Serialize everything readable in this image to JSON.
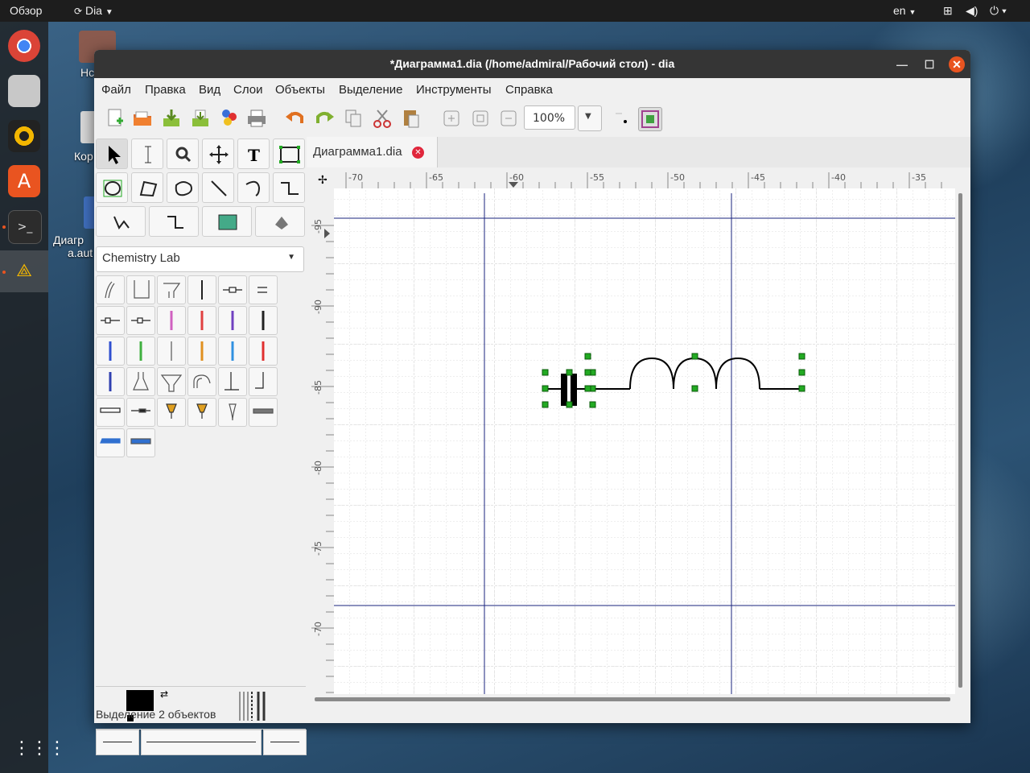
{
  "topbar": {
    "activities": "Обзор",
    "app_menu": "Dia",
    "lang": "en"
  },
  "desktop": {
    "icon1": "Hc",
    "icon2": "Кор",
    "icon3_line1": "Диагр",
    "icon3_line2": "a.aut"
  },
  "window": {
    "title": "*Диаграмма1.dia (/home/admiral/Рабочий стол) - dia"
  },
  "menu": [
    "Файл",
    "Правка",
    "Вид",
    "Слои",
    "Объекты",
    "Выделение",
    "Инструменты",
    "Справка"
  ],
  "toolbar": {
    "zoom": "100%"
  },
  "sheet": {
    "selected": "Chemistry Lab"
  },
  "tab": {
    "label": "Диаграмма1.dia"
  },
  "rulers": {
    "horizontal": [
      "-70",
      "-65",
      "-60",
      "-55",
      "-50",
      "-45",
      "-40",
      "-35"
    ],
    "vertical": [
      "-95",
      "-90",
      "-85",
      "-80",
      "-75",
      "-70"
    ]
  },
  "status": {
    "text": "Выделение 2 объектов"
  },
  "colors": {
    "accent": "#e95420",
    "handle": "#22aa22",
    "guide": "#1a237e"
  }
}
